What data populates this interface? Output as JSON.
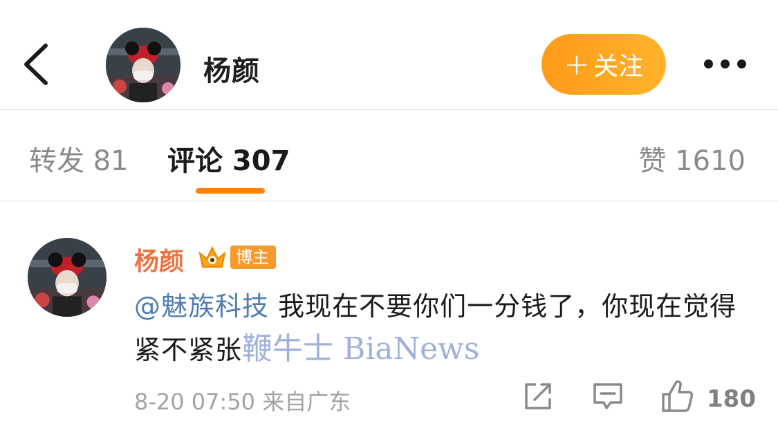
{
  "header": {
    "user_name": "杨颜",
    "follow_label": "关注",
    "icons": [
      "back-arrow-icon",
      "more-dots-icon"
    ]
  },
  "tabs": {
    "repost": "转发 81",
    "comment": "评论 307",
    "like": "赞 1610"
  },
  "comment": {
    "user_name": "杨颜",
    "badge_label": "博主",
    "mention": "@魅族科技",
    "text_line": " 我现在不要你们一分钱了，你现在觉得紧不紧张",
    "watermark": "鞭牛士 BiaNews",
    "meta": "8-20 07:50  来自广东",
    "like_count": "180"
  },
  "colors": {
    "accent": "#ff8200",
    "follow_gradient_start": "#ff9a1a",
    "follow_gradient_end": "#ffb32a",
    "username_orange": "#eb7340",
    "mention_blue": "#507daf"
  }
}
